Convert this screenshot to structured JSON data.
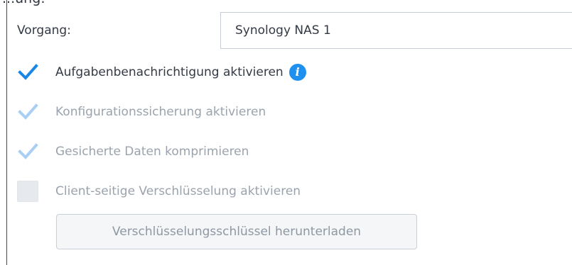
{
  "header": {
    "fragment": "...ung:"
  },
  "task": {
    "label": "Vorgang:",
    "value": "Synology NAS 1"
  },
  "options": [
    {
      "label": "Aufgabenbenachrichtigung aktivieren",
      "checked": true,
      "disabled": false,
      "info": true
    },
    {
      "label": "Konfigurationssicherung aktivieren",
      "checked": true,
      "disabled": true
    },
    {
      "label": "Gesicherte Daten komprimieren",
      "checked": true,
      "disabled": true
    },
    {
      "label": "Client-seitige Verschlüsselung aktivieren",
      "checked": false,
      "disabled": true
    }
  ],
  "download_button": {
    "label": "Verschlüsselungsschlüssel herunterladen",
    "disabled": true
  },
  "colors": {
    "check_enabled": "#1a87e6",
    "check_disabled": "#a9cff3",
    "info_icon": "#1f8ff0"
  },
  "icons": {
    "check": "checkmark-icon",
    "info": "info-icon"
  }
}
